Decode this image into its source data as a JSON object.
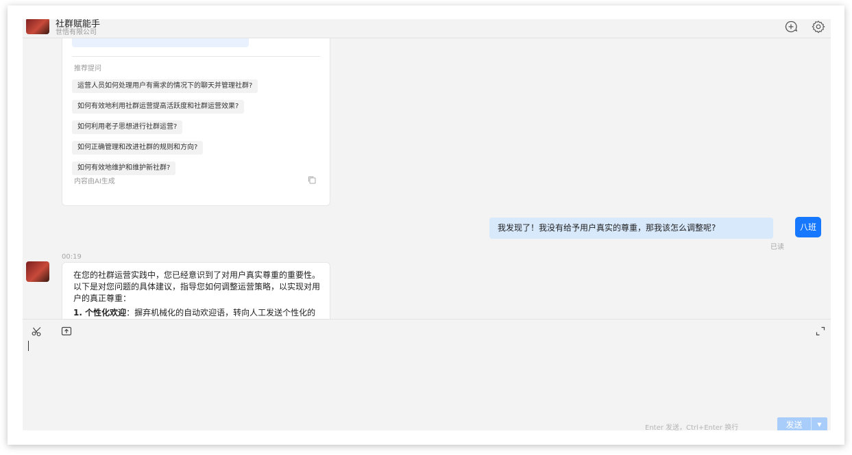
{
  "header": {
    "title": "社群赋能手",
    "subtitle": "世悟有限公司",
    "icons": [
      "add-chat-icon",
      "settings-icon"
    ]
  },
  "messages": {
    "recommend_card": {
      "title": "推荐提问",
      "items": [
        "运营人员如何处理用户有需求的情况下的聊天并管理社群?",
        "如何有效地利用社群运营提高活跃度和社群运营效果?",
        "如何利用老子思想进行社群运营?",
        "如何正确管理和改进社群的规则和方向?",
        "如何有效地维护和维护新社群?"
      ],
      "ai_note": "内容由AI生成"
    },
    "outgoing": {
      "text": "我发现了！我没有给予用户真实的尊重，那我该怎么调整呢?",
      "avatar_text": "八班",
      "status": "已读"
    },
    "incoming": {
      "time": "00:19",
      "paragraph1": "在您的社群运营实践中，您已经意识到了对用户真实尊重的重要性。以下是对您问题的具体建议，指导您如何调整运营策略，以实现对用户的真正尊重：",
      "point1_title": "1. 个性化欢迎",
      "point1_text": "：摒弃机械化的自动欢迎语，转向人工发送个性化的欢迎信息。针对每位新加入的成员，您可以亲自编写一段温馨、诚挚的欢迎词，表达对他们"
    }
  },
  "composer": {
    "hint": "Enter 发送，Ctrl+Enter 换行",
    "send_label": "发送"
  },
  "colors": {
    "accent": "#1677ff",
    "out_bubble": "#d8e9fc",
    "send_disabled": "#a9cdfb"
  }
}
